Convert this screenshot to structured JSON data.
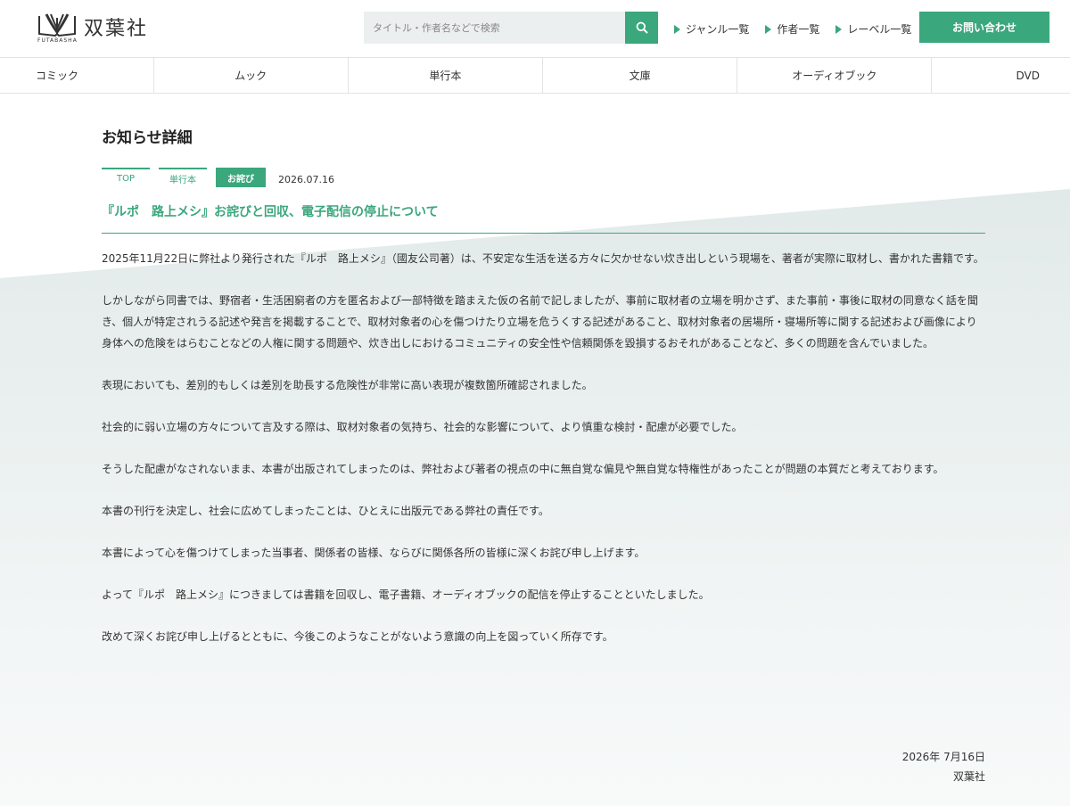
{
  "header": {
    "logo_text": "双葉社",
    "logo_sub": "FUTABASHA",
    "search_placeholder": "タイトル・作者名などで検索",
    "links": [
      {
        "label": "ジャンル一覧"
      },
      {
        "label": "作者一覧"
      },
      {
        "label": "レーベル一覧"
      }
    ],
    "contact_label": "お問い合わせ"
  },
  "categories": [
    {
      "label": "コミック"
    },
    {
      "label": "ムック"
    },
    {
      "label": "単行本"
    },
    {
      "label": "文庫"
    },
    {
      "label": "オーディオブック"
    },
    {
      "label": "DVD"
    }
  ],
  "article": {
    "page_title": "お知らせ詳細",
    "tags": [
      "TOP",
      "単行本",
      "お詫び"
    ],
    "date": "2026.07.16",
    "headline": "『ルポ　路上メシ』お詫びと回収、電子配信の停止について",
    "paragraphs": [
      "2025年11月22日に弊社より発行された『ルポ　路上メシ』（國友公司著）は、不安定な生活を送る方々に欠かせない炊き出しという現場を、著者が実際に取材し、書かれた書籍です。",
      "しかしながら同書では、野宿者・生活困窮者の方を匿名および一部特徴を踏まえた仮の名前で記しましたが、事前に取材者の立場を明かさず、また事前・事後に取材の同意なく話を聞き、個人が特定されうる記述や発言を掲載することで、取材対象者の心を傷つけたり立場を危うくする記述があること、取材対象者の居場所・寝場所等に関する記述および画像により身体への危険をはらむことなどの人権に関する問題や、炊き出しにおけるコミュニティの安全性や信頼関係を毀損するおそれがあることなど、多くの問題を含んでいました。",
      "表現においても、差別的もしくは差別を助長する危険性が非常に高い表現が複数箇所確認されました。",
      "社会的に弱い立場の方々について言及する際は、取材対象者の気持ち、社会的な影響について、より慎重な検討・配慮が必要でした。",
      "そうした配慮がなされないまま、本書が出版されてしまったのは、弊社および著者の視点の中に無自覚な偏見や無自覚な特権性があったことが問題の本質だと考えております。",
      "本書の刊行を決定し、社会に広めてしまったことは、ひとえに出版元である弊社の責任です。",
      "本書によって心を傷つけてしまった当事者、関係者の皆様、ならびに関係各所の皆様に深くお詫び申し上げます。",
      "よって『ルポ　路上メシ』につきましては書籍を回収し、電子書籍、オーディオブックの配信を停止することといたしました。",
      "改めて深くお詫び申し上げるとともに、今後このようなことがないよう意識の向上を図っていく所存です。"
    ],
    "sign_date": "2026年 7月16日",
    "sign_name": "双葉社"
  },
  "colors": {
    "accent": "#3aa77d",
    "background_tint": "#e4ebea"
  }
}
